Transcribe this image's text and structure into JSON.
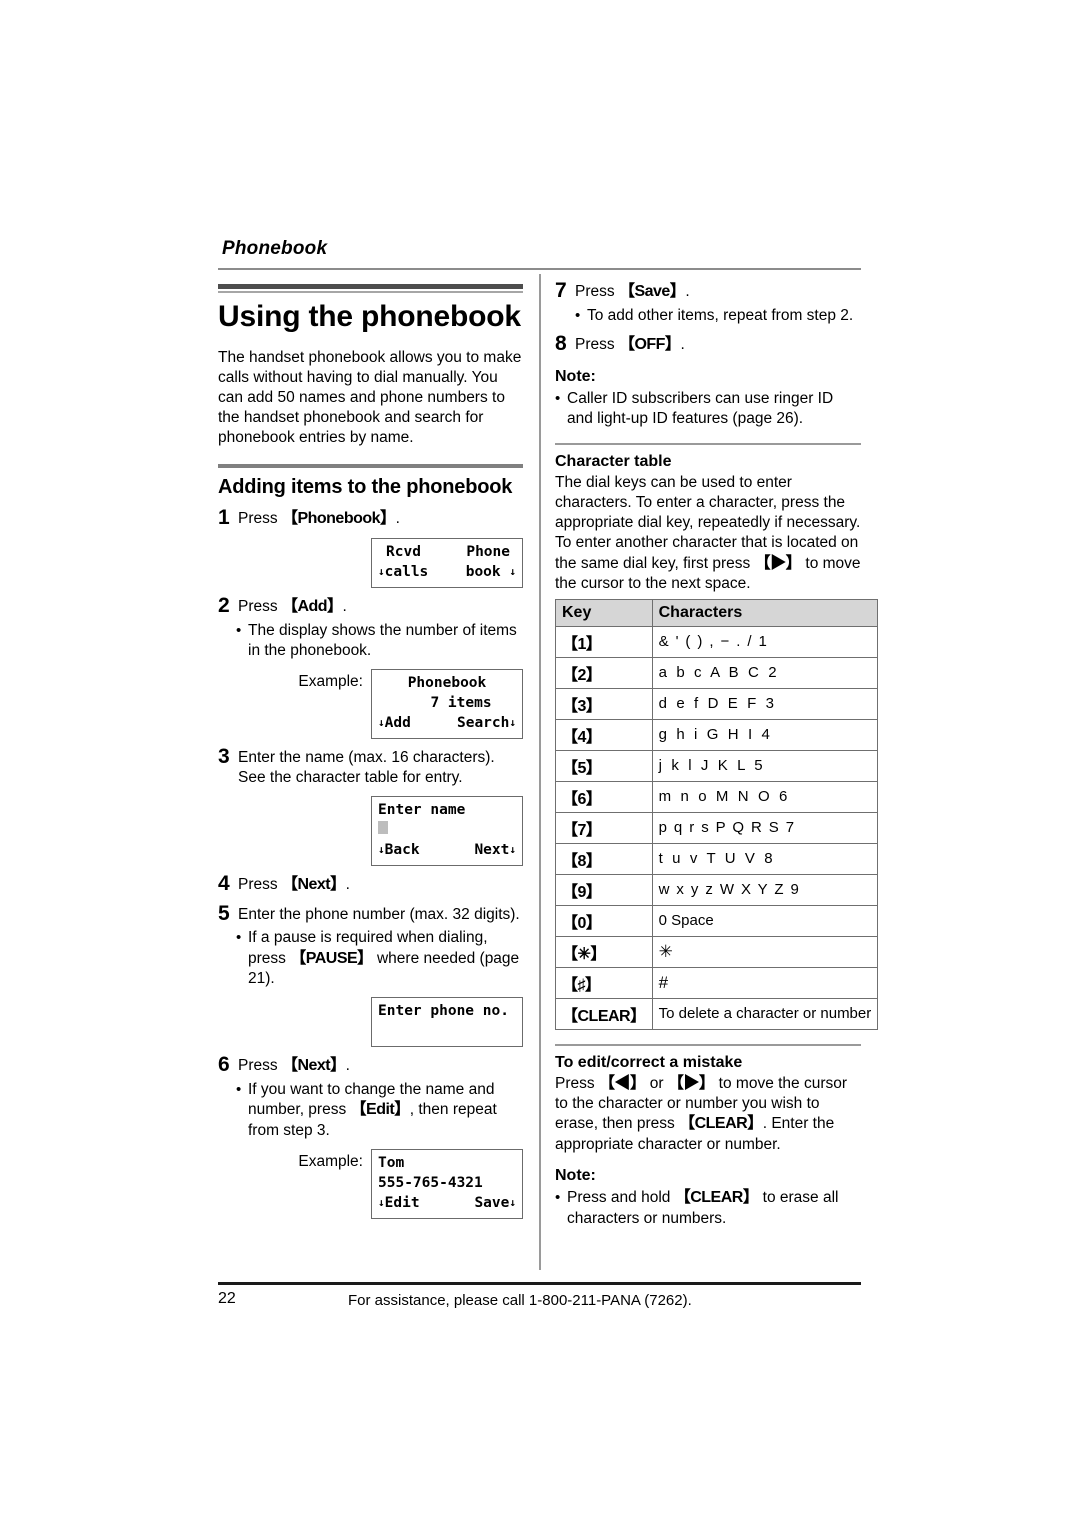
{
  "header": {
    "running_head": "Phonebook"
  },
  "left": {
    "section_title": "Using the phonebook",
    "intro": "The handset phonebook allows you to make calls without having to dial manually. You can add 50 names and phone numbers to the handset phonebook and search for phonebook entries by name.",
    "subsection_title": "Adding items to the phonebook",
    "step1": {
      "num": "1",
      "pre": "Press ",
      "key": "【Phonebook】",
      "post": "."
    },
    "lcd1": {
      "l1": "Rcvd",
      "r1": "Phone",
      "l2": "calls",
      "r2": "book",
      "sk_left": "↓",
      "sk_right": "↓"
    },
    "step2": {
      "num": "2",
      "pre": "Press ",
      "key": "【Add】",
      "post": "."
    },
    "step2_bullet": "The display shows the number of items in the phonebook.",
    "example_label": "Example:",
    "lcd2": {
      "l1": "Phonebook",
      "l2": "7 items",
      "l3": "Add",
      "r3": "Search"
    },
    "step3": {
      "num": "3",
      "text": "Enter the name (max. 16 characters). See the character table for entry."
    },
    "lcd3": {
      "l1": "Enter name",
      "l3": "Back",
      "r3": "Next"
    },
    "step4": {
      "num": "4",
      "pre": "Press ",
      "key": "【Next】",
      "post": "."
    },
    "step5": {
      "num": "5",
      "text": "Enter the phone number (max. 32 digits)."
    },
    "step5_bullet": {
      "a": "If a pause is required when dialing, press ",
      "key": "【PAUSE】",
      "b": " where needed (page 21)."
    },
    "lcd4": {
      "l1": "Enter phone no."
    },
    "step6": {
      "num": "6",
      "pre": "Press ",
      "key": "【Next】",
      "post": "."
    },
    "step6_bullet": {
      "a": "If you want to change the name and number, press ",
      "key": "【Edit】",
      "b": ", then repeat from step 3."
    },
    "example_label2": "Example:",
    "lcd5": {
      "l1": "Tom",
      "l2": "555-765-4321",
      "l3": "Edit",
      "r3": "Save"
    }
  },
  "right": {
    "step7": {
      "num": "7",
      "pre": "Press ",
      "key": "【Save】",
      "post": "."
    },
    "step7_bullet": "To add other items, repeat from step 2.",
    "step8": {
      "num": "8",
      "pre": "Press ",
      "key": "【OFF】",
      "post": "."
    },
    "note1_label": "Note:",
    "note1_bullet": "Caller ID subscribers can use ringer ID and light-up ID features (page 26).",
    "chartable_title": "Character table",
    "chartable_intro_a": "The dial keys can be used to enter characters. To enter a character, press the appropriate dial key, repeatedly if necessary. To enter another character that is located on the same dial key, first press ",
    "chartable_intro_key": "【▶】",
    "chartable_intro_b": " to move the cursor to the next space.",
    "table": {
      "headers": [
        "Key",
        "Characters"
      ],
      "rows": [
        {
          "key": "【1】",
          "chars": "& ' ( ) , − . / 1",
          "style": "wide"
        },
        {
          "key": "【2】",
          "chars": "a b c A B C 2",
          "style": ""
        },
        {
          "key": "【3】",
          "chars": "d e f D E F 3",
          "style": ""
        },
        {
          "key": "【4】",
          "chars": "g h i G H I 4",
          "style": ""
        },
        {
          "key": "【5】",
          "chars": "j k l J K L 5",
          "style": ""
        },
        {
          "key": "【6】",
          "chars": "m n o M N O 6",
          "style": ""
        },
        {
          "key": "【7】",
          "chars": "p q r s P Q R S 7",
          "style": "wide"
        },
        {
          "key": "【8】",
          "chars": "t u v T U V 8",
          "style": ""
        },
        {
          "key": "【9】",
          "chars": "w x y z W X Y Z 9",
          "style": "wide"
        },
        {
          "key": "【0】",
          "chars": "0   Space",
          "style": "plain"
        },
        {
          "key": "【✳】",
          "chars": "✳",
          "style": "sym"
        },
        {
          "key": "【♯】",
          "chars": "#",
          "style": "sym"
        },
        {
          "key": "【CLEAR】",
          "chars": "To delete a character or number",
          "style": "plain"
        }
      ]
    },
    "edit_title": "To edit/correct a mistake",
    "edit_a": "Press ",
    "edit_k1": "【◀】",
    "edit_mid": " or ",
    "edit_k2": "【▶】",
    "edit_b": " to move the cursor to the character or number you wish to erase, then press ",
    "edit_k3": "【CLEAR】",
    "edit_c": ". Enter the appropriate character or number.",
    "note2_label": "Note:",
    "note2_a": "Press and hold ",
    "note2_key": "【CLEAR】",
    "note2_b": " to erase all characters or numbers."
  },
  "footer": {
    "page_number": "22",
    "assistance": "For assistance, please call 1-800-211-PANA (7262)."
  }
}
